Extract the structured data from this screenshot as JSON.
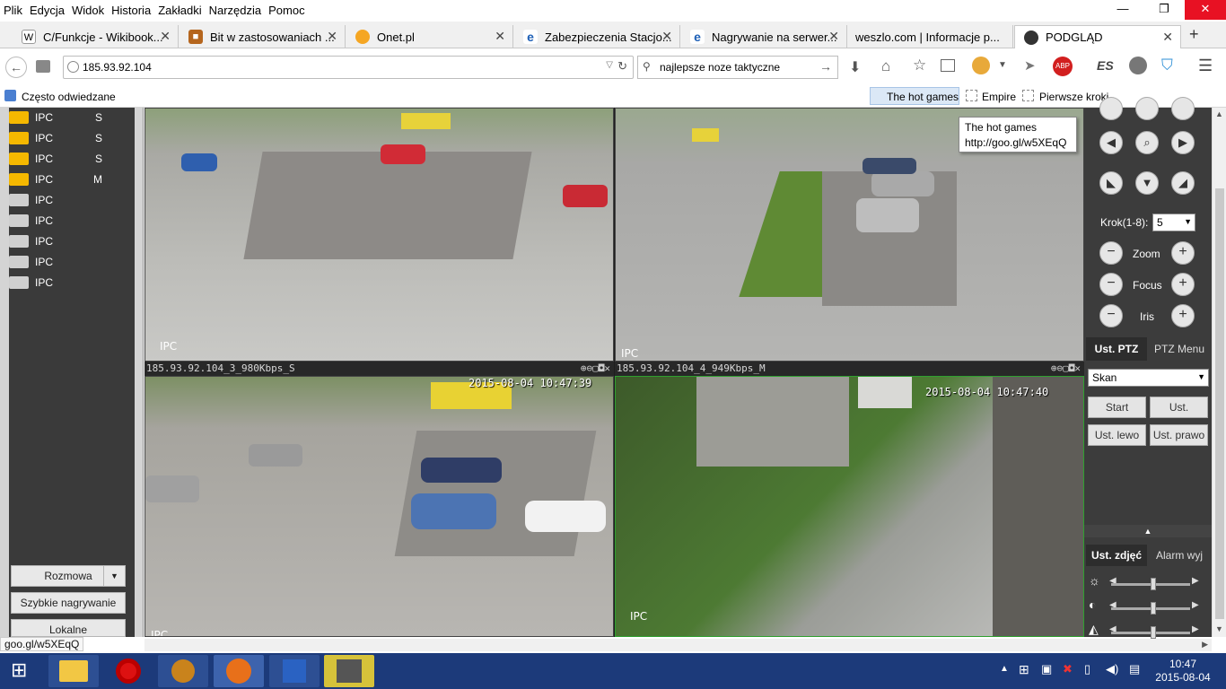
{
  "menu": [
    "Plik",
    "Edycja",
    "Widok",
    "Historia",
    "Zakładki",
    "Narzędzia",
    "Pomoc"
  ],
  "tabs": [
    {
      "title": "C/Funkcje - Wikibook...",
      "icon": "wiki-icon",
      "color": "#ffffff"
    },
    {
      "title": "Bit w zastosowaniach ...",
      "icon": "bookmark-favicon-icon",
      "color": "#b5651d"
    },
    {
      "title": "Onet.pl",
      "icon": "onet-icon",
      "color": "#f5a623"
    },
    {
      "title": "Zabezpieczenia Stacjo...",
      "icon": "ie-icon",
      "color": "#1d5fb6"
    },
    {
      "title": "Nagrywanie na serwer...",
      "icon": "ie-icon",
      "color": "#1d5fb6"
    },
    {
      "title": "weszlo.com | Informacje p...",
      "icon": "page-icon",
      "color": "#ffffff"
    },
    {
      "title": "PODGLĄD",
      "icon": "camera-icon",
      "color": "#333333"
    }
  ],
  "nav": {
    "url": "185.93.92.104",
    "search": "najlepsze noze taktyczne"
  },
  "bookmarks": {
    "often": "Często odwiedzane",
    "items": [
      "The hot games",
      "Empire",
      "Pierwsze kroki"
    ]
  },
  "tooltip": {
    "line1": "The hot games",
    "line2": "http://goo.gl/w5XEqQ"
  },
  "channels": [
    {
      "label": "IPC",
      "flag": "S",
      "color": "#f5b800"
    },
    {
      "label": "IPC",
      "flag": "S",
      "color": "#f5b800"
    },
    {
      "label": "IPC",
      "flag": "S",
      "color": "#f5b800"
    },
    {
      "label": "IPC",
      "flag": "M",
      "color": "#f5b800"
    },
    {
      "label": "IPC",
      "flag": "",
      "color": "#cfcfcf"
    },
    {
      "label": "IPC",
      "flag": "",
      "color": "#cfcfcf"
    },
    {
      "label": "IPC",
      "flag": "",
      "color": "#cfcfcf"
    },
    {
      "label": "IPC",
      "flag": "",
      "color": "#cfcfcf"
    },
    {
      "label": "IPC",
      "flag": "",
      "color": "#cfcfcf"
    }
  ],
  "left_buttons": {
    "talk": "Rozmowa",
    "quick_rec": "Szybkie nagrywanie",
    "local": "Lokalne"
  },
  "cameras": [
    {
      "header": "",
      "ipc": "IPC",
      "stamp": ""
    },
    {
      "header": "",
      "ipc": "IPC",
      "stamp": ""
    },
    {
      "header": "185.93.92.104_3_980Kbps_S",
      "ipc": "IPC",
      "stamp": "2015-08-04 10:47:39"
    },
    {
      "header": "185.93.92.104_4_949Kbps_M",
      "ipc": "IPC",
      "stamp": "2015-08-04 10:47:40"
    }
  ],
  "ptz": {
    "step_label": "Krok(1-8):",
    "step_value": "5",
    "zoom": "Zoom",
    "focus": "Focus",
    "iris": "Iris",
    "tab_settings": "Ust. PTZ",
    "tab_menu": "PTZ Menu",
    "mode": "Skan",
    "start": "Start",
    "set": "Ust.",
    "left": "Ust. lewo",
    "right": "Ust. prawo",
    "tab_image": "Ust. zdjęć",
    "tab_alarm": "Alarm wyj"
  },
  "image_levels": {
    "brightness": 0.5,
    "contrast": 0.5,
    "saturation": 0.5
  },
  "status_url": "goo.gl/w5XEqQ",
  "clock": {
    "time": "10:47",
    "date": "2015-08-04"
  }
}
